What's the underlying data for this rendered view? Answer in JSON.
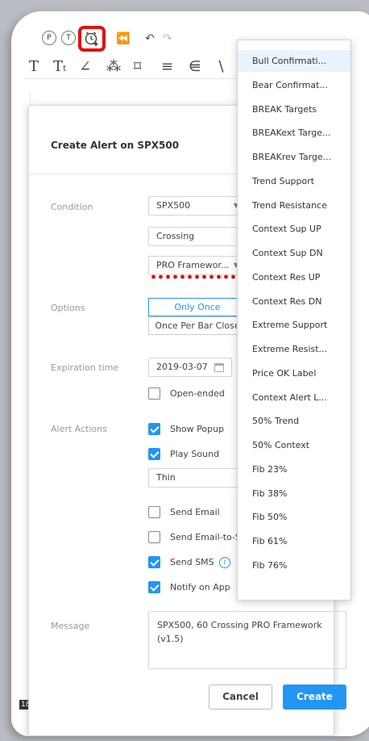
{
  "toolbar": {
    "btn_p": "P",
    "btn_t": "T"
  },
  "chart": {
    "scale_fragment": "18"
  },
  "dialog": {
    "title": "Create Alert on SPX500",
    "condition": {
      "label": "Condition",
      "symbol": "SPX500",
      "operator": "Crossing",
      "indicator": "PRO Framewor..."
    },
    "options": {
      "label": "Options",
      "only_once": "Only Once",
      "once_per_bar_close": "Once Per Bar Close"
    },
    "expiration": {
      "label": "Expiration time",
      "date": "2019-03-07",
      "open_ended": "Open-ended"
    },
    "actions": {
      "label": "Alert Actions",
      "show_popup": "Show Popup",
      "play_sound": "Play Sound",
      "sound": "Thin",
      "send_email": "Send Email",
      "send_email_sms": "Send Email-to-SMS",
      "send_sms": "Send SMS",
      "notify_app": "Notify on App"
    },
    "message": {
      "label": "Message",
      "text": "SPX500, 60 Crossing PRO Framework (v1.5)"
    },
    "cancel": "Cancel",
    "create": "Create"
  },
  "dropdown": {
    "items": [
      "Bull Confirmati...",
      "Bear Confirmat...",
      "BREAK Targets",
      "BREAKext Targe...",
      "BREAKrev Targe...",
      "Trend Support",
      "Trend Resistance",
      "Context Sup UP",
      "Context Sup DN",
      "Context Res UP",
      "Context Res DN",
      "Extreme Support",
      "Extreme Resist...",
      "Price OK Label",
      "Context Alert L...",
      "50% Trend",
      "50% Context",
      "Fib 23%",
      "Fib 38%",
      "Fib 50%",
      "Fib 61%",
      "Fib 76%"
    ]
  },
  "colors": {
    "accent": "#2196f3",
    "highlight_red": "#e01010"
  }
}
